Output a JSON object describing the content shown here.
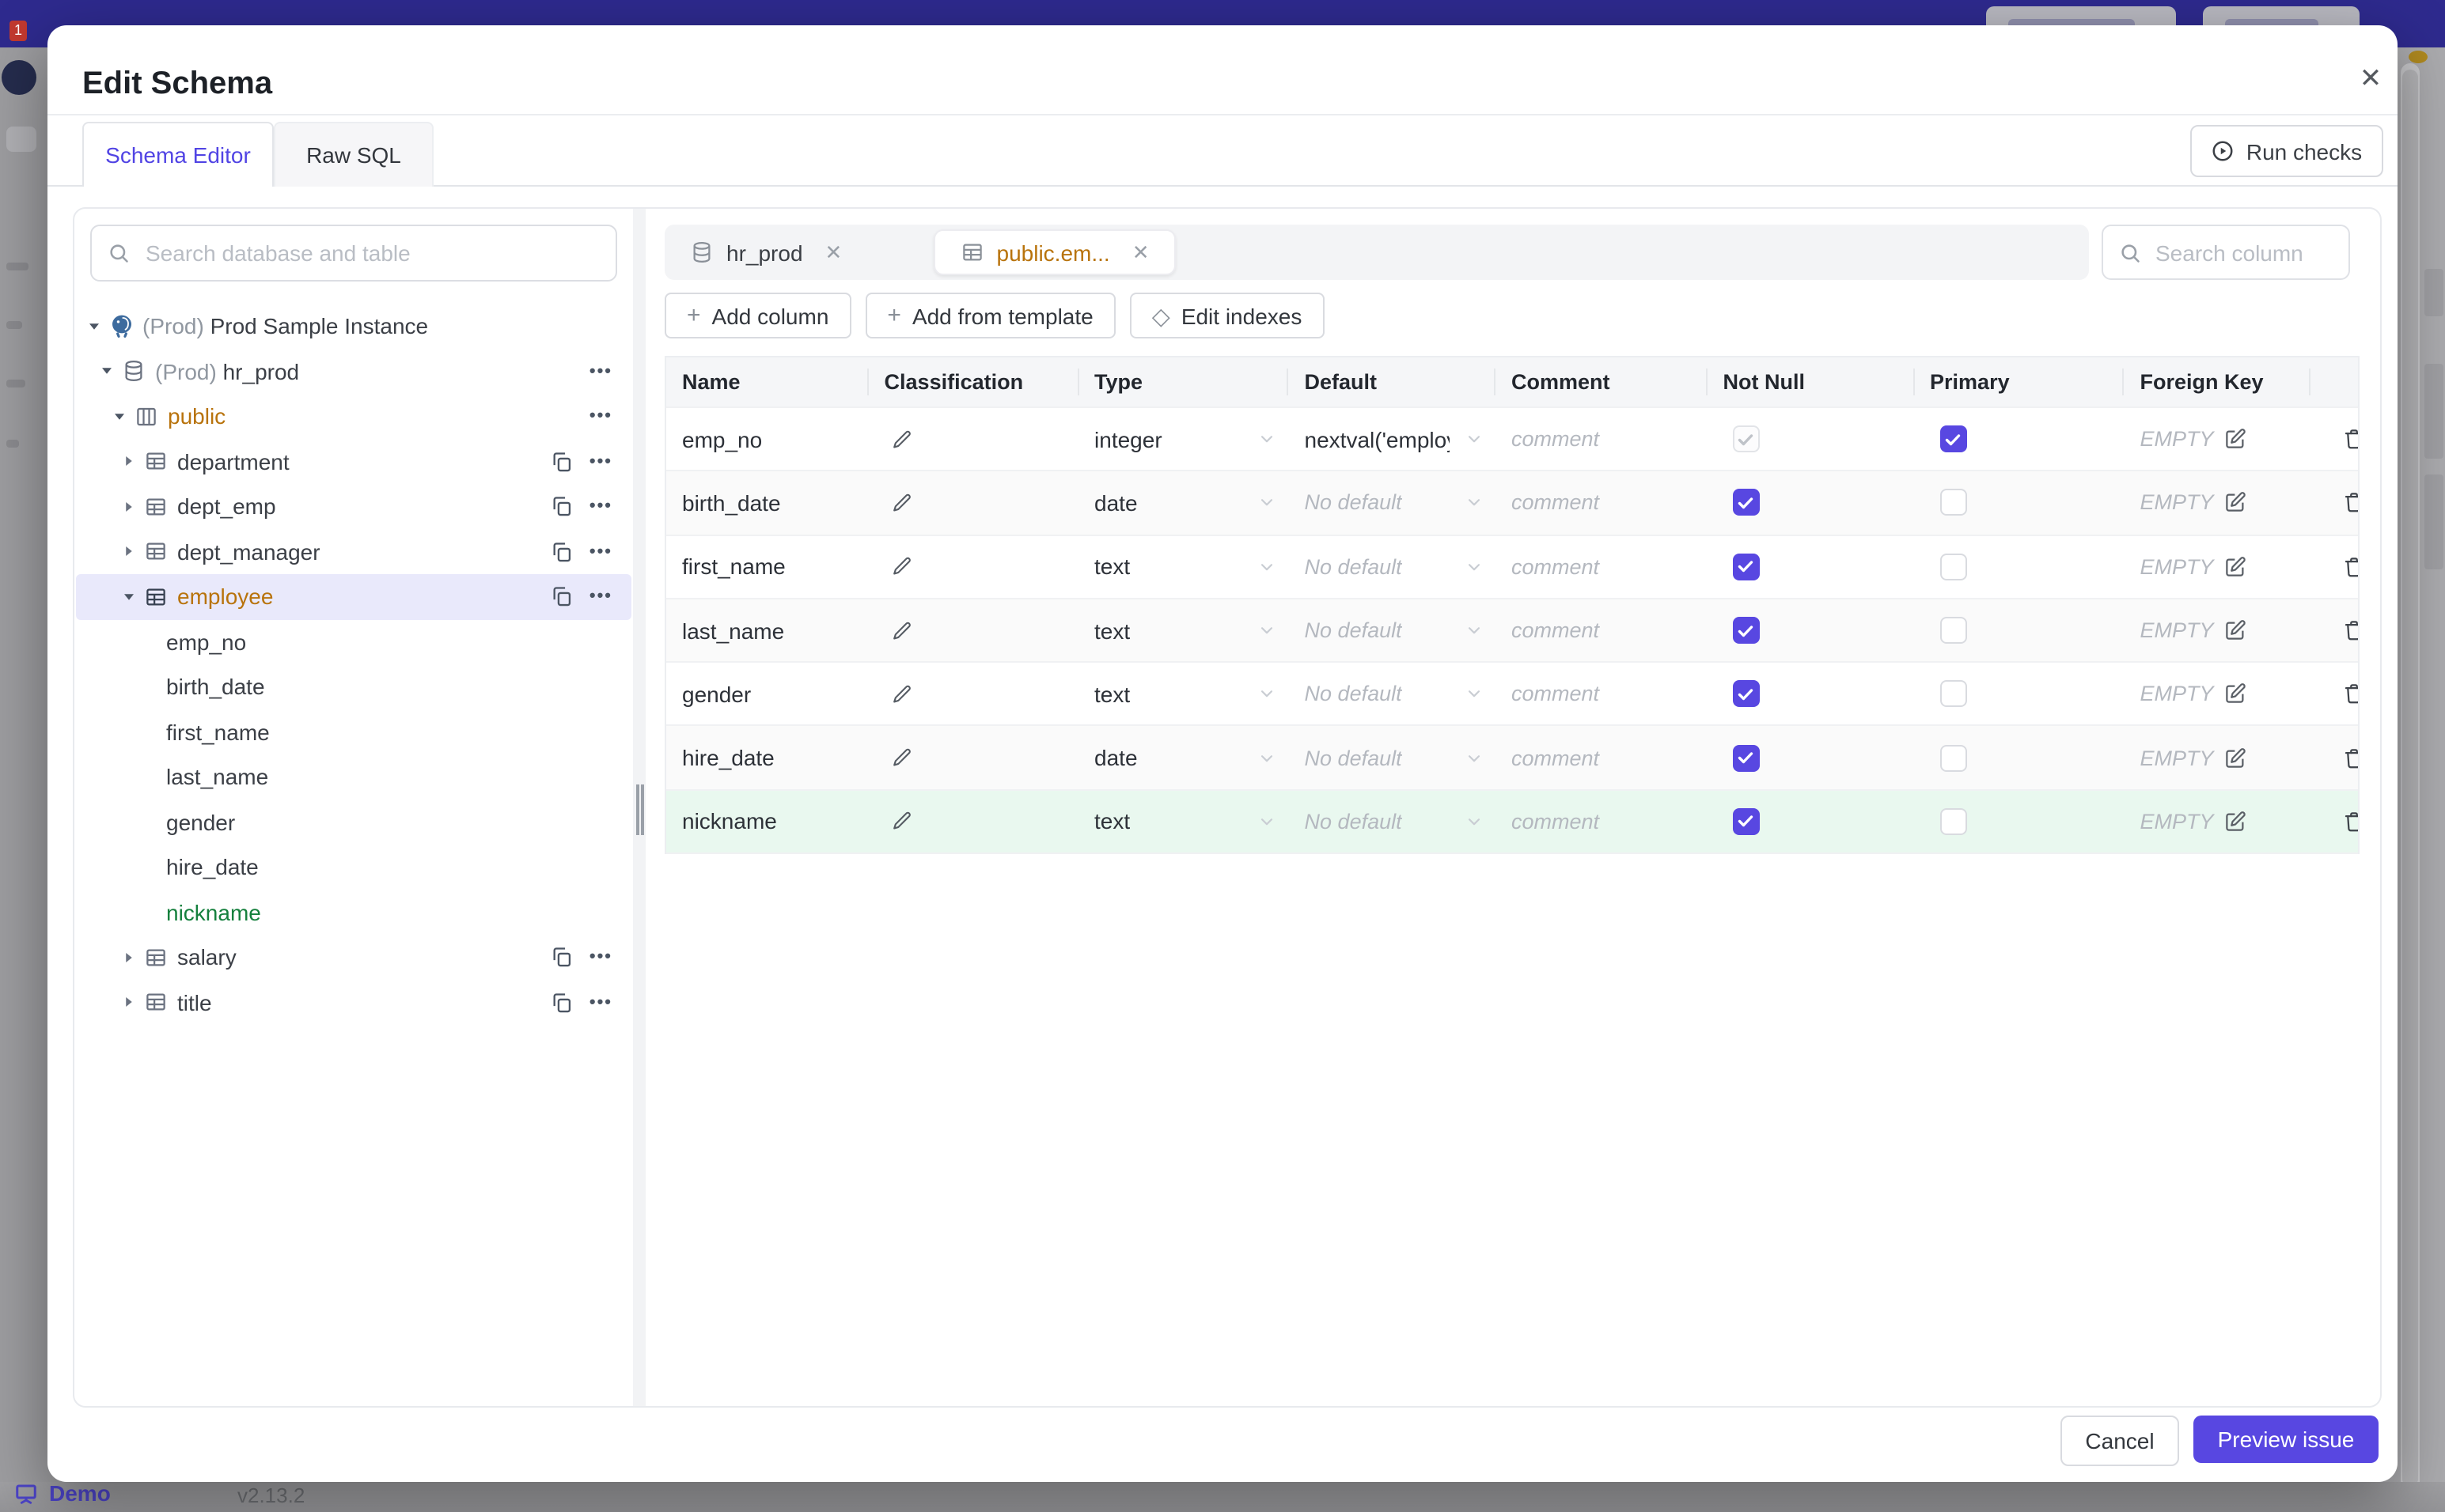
{
  "colors": {
    "topbar": "#2e2a8e",
    "accent": "#5847e1",
    "amber": "#b8730c",
    "green": "#15803d",
    "green_row_bg": "#e9f8ef",
    "selected_row_bg": "#e9e9fb"
  },
  "backdrop": {
    "demo_label": "Demo",
    "version": "v2.13.2"
  },
  "modal": {
    "title": "Edit Schema",
    "tabs": [
      {
        "label": "Schema Editor",
        "active": true
      },
      {
        "label": "Raw SQL",
        "active": false
      }
    ],
    "run_checks_label": "Run checks",
    "sidebar": {
      "search_placeholder": "Search database and table",
      "tree": [
        {
          "level": 0,
          "caret": "expanded",
          "icon": "postgres",
          "prefix": "(Prod) ",
          "label": "Prod Sample Instance"
        },
        {
          "level": 1,
          "caret": "expanded",
          "icon": "database",
          "prefix": "(Prod) ",
          "label": "hr_prod",
          "more": true
        },
        {
          "level": 2,
          "caret": "expanded",
          "icon": "schema",
          "label": "public",
          "color": "amber",
          "more": true
        },
        {
          "level": 3,
          "caret": "collapsed",
          "icon": "table",
          "label": "department",
          "copy": true,
          "more": true
        },
        {
          "level": 3,
          "caret": "collapsed",
          "icon": "table",
          "label": "dept_emp",
          "copy": true,
          "more": true
        },
        {
          "level": 3,
          "caret": "collapsed",
          "icon": "table",
          "label": "dept_manager",
          "copy": true,
          "more": true
        },
        {
          "level": 3,
          "caret": "expanded",
          "icon": "table",
          "label": "employee",
          "color": "amber",
          "selected": true,
          "copy": true,
          "more": true
        },
        {
          "level": 4,
          "label": "emp_no"
        },
        {
          "level": 4,
          "label": "birth_date"
        },
        {
          "level": 4,
          "label": "first_name"
        },
        {
          "level": 4,
          "label": "last_name"
        },
        {
          "level": 4,
          "label": "gender"
        },
        {
          "level": 4,
          "label": "hire_date"
        },
        {
          "level": 4,
          "label": "nickname",
          "color": "green"
        },
        {
          "level": 3,
          "caret": "collapsed",
          "icon": "table",
          "label": "salary",
          "copy": true,
          "more": true
        },
        {
          "level": 3,
          "caret": "collapsed",
          "icon": "table",
          "label": "title",
          "copy": true,
          "more": true
        }
      ]
    },
    "editor": {
      "tabs": [
        {
          "icon": "database",
          "label": "hr_prod",
          "active": false
        },
        {
          "icon": "table",
          "label": "public.em...",
          "active": true,
          "color": "amber"
        }
      ],
      "column_search_placeholder": "Search column",
      "toolbar": [
        {
          "icon": "plus",
          "label": "Add column"
        },
        {
          "icon": "plus",
          "label": "Add from template"
        },
        {
          "icon": "diamond",
          "label": "Edit indexes"
        }
      ],
      "table": {
        "headers": [
          "Name",
          "Classification",
          "Type",
          "Default",
          "Comment",
          "Not Null",
          "Primary",
          "Foreign Key",
          ""
        ],
        "comment_placeholder": "comment",
        "foreign_key_empty": "EMPTY",
        "rows": [
          {
            "name": "emp_no",
            "type": "integer",
            "default": "nextval('employ",
            "default_placeholder": false,
            "not_null": "checked-disabled",
            "primary": "checked",
            "highlight": null
          },
          {
            "name": "birth_date",
            "type": "date",
            "default": "No default",
            "default_placeholder": true,
            "not_null": "checked",
            "primary": "unchecked",
            "highlight": null
          },
          {
            "name": "first_name",
            "type": "text",
            "default": "No default",
            "default_placeholder": true,
            "not_null": "checked",
            "primary": "unchecked",
            "highlight": null
          },
          {
            "name": "last_name",
            "type": "text",
            "default": "No default",
            "default_placeholder": true,
            "not_null": "checked",
            "primary": "unchecked",
            "highlight": null
          },
          {
            "name": "gender",
            "type": "text",
            "default": "No default",
            "default_placeholder": true,
            "not_null": "checked",
            "primary": "unchecked",
            "highlight": null
          },
          {
            "name": "hire_date",
            "type": "date",
            "default": "No default",
            "default_placeholder": true,
            "not_null": "checked",
            "primary": "unchecked",
            "highlight": null
          },
          {
            "name": "nickname",
            "type": "text",
            "default": "No default",
            "default_placeholder": true,
            "not_null": "checked",
            "primary": "unchecked",
            "highlight": "green"
          }
        ]
      }
    },
    "footer": {
      "cancel_label": "Cancel",
      "primary_label": "Preview issue"
    }
  }
}
